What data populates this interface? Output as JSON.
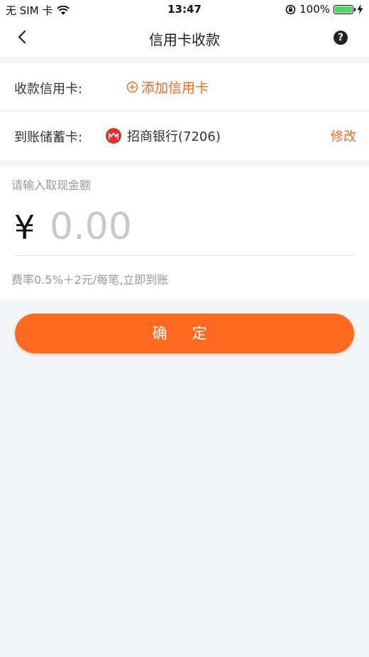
{
  "status_bar": {
    "carrier": "无 SIM 卡",
    "time": "13:47",
    "battery_text": "100%",
    "battery_level": 100
  },
  "nav": {
    "title": "信用卡收款",
    "help_icon": "?"
  },
  "credit_row": {
    "label": "收款信用卡:",
    "add_label": "添加信用卡"
  },
  "debit_row": {
    "label": "到账储蓄卡:",
    "bank_name": "招商银行(7206)",
    "modify_label": "修改"
  },
  "amount": {
    "hint": "请输入取现金额",
    "currency": "¥",
    "placeholder": "0.00",
    "fee_text": "费率0.5%＋2元/每笔,立即到账"
  },
  "confirm_label": "确 定",
  "colors": {
    "accent": "#ff6a22",
    "background": "#f4f5f7",
    "bank_logo": "#e0302f"
  }
}
